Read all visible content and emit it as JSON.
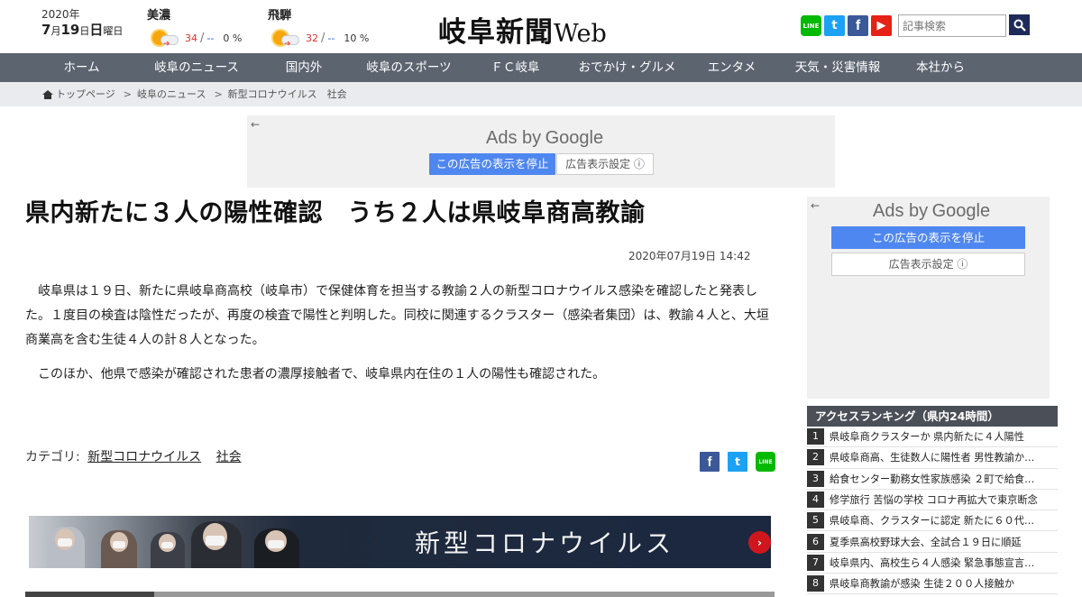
{
  "header": {
    "date_year": "2020年",
    "date_month": "7",
    "date_month_unit": "月",
    "date_day": "19",
    "date_day_unit": "日",
    "date_weekday": "日",
    "date_weekday_unit": "曜日",
    "weather": [
      {
        "region": "美濃",
        "icon": "sunny-then-cloudy-icon",
        "high": "34",
        "low": "--",
        "precip": "0 %"
      },
      {
        "region": "飛騨",
        "icon": "sunny-then-cloudy-icon",
        "high": "32",
        "low": "--",
        "precip": "10 %"
      }
    ],
    "logo_text": "岐阜新聞",
    "logo_suffix": "Web",
    "social": {
      "line": "LINE",
      "twitter": "t",
      "facebook": "f",
      "youtube": "▶"
    },
    "search_placeholder": "記事検索"
  },
  "nav": {
    "items": [
      "ホーム",
      "岐阜のニュース",
      "国内外",
      "岐阜のスポーツ",
      "ＦＣ岐阜",
      "おでかけ・グルメ",
      "エンタメ",
      "天気・災害情報",
      "本社から"
    ]
  },
  "breadcrumb": {
    "home": "トップページ",
    "items": [
      "岐阜のニュース",
      "新型コロナウイルス　社会"
    ]
  },
  "ads": {
    "ads_by": "Ads by",
    "google": "Google",
    "stop_label": "この広告の表示を停止",
    "settings_label": "広告表示設定 ⓘ",
    "back_arrow": "←"
  },
  "article": {
    "headline": "県内新たに３人の陽性確認　うち２人は県岐阜商高教諭",
    "date": "2020年07月19日 14:42",
    "paragraphs": [
      "岐阜県は１９日、新たに県岐阜商高校（岐阜市）で保健体育を担当する教諭２人の新型コロナウイルス感染を確認したと発表した。１度目の検査は陰性だったが、再度の検査で陽性と判明した。同校に関連するクラスター（感染者集団）は、教諭４人と、大垣商業高を含む生徒４人の計８人となった。",
      "このほか、他県で感染が確認された患者の濃厚接触者で、岐阜県内在住の１人の陽性も確認された。"
    ],
    "category_label": "カテゴリ:",
    "categories": [
      "新型コロナウイルス",
      "社会"
    ],
    "banner_text": "新型コロナウイルス",
    "banner_arrow": "›"
  },
  "ranking": {
    "title": "アクセスランキング（県内24時間）",
    "items": [
      {
        "rank": "1",
        "text": "県岐阜商クラスターか 県内新たに４人陽性"
      },
      {
        "rank": "2",
        "text": "県岐阜商高、生徒数人に陽性者 男性教諭か…"
      },
      {
        "rank": "3",
        "text": "給食センター勤務女性家族感染 ２町で給食…"
      },
      {
        "rank": "4",
        "text": "修学旅行 苦悩の学校 コロナ再拡大で東京断念"
      },
      {
        "rank": "5",
        "text": "県岐阜商、クラスターに認定 新たに６０代…"
      },
      {
        "rank": "6",
        "text": "夏季県高校野球大会、全試合１９日に順延"
      },
      {
        "rank": "7",
        "text": "岐阜県内、高校生ら４人感染 緊急事態宣言…"
      },
      {
        "rank": "8",
        "text": "県岐阜商教諭が感染 生徒２００人接触か"
      }
    ]
  },
  "colors": {
    "nav_bg": "#5c6470",
    "breadcrumb_bg": "#e9ebee",
    "ad_button_blue": "#4f87f0",
    "ranking_header": "#4b4f57",
    "temp_high": "#e0302a",
    "temp_low": "#2a5bd7"
  }
}
